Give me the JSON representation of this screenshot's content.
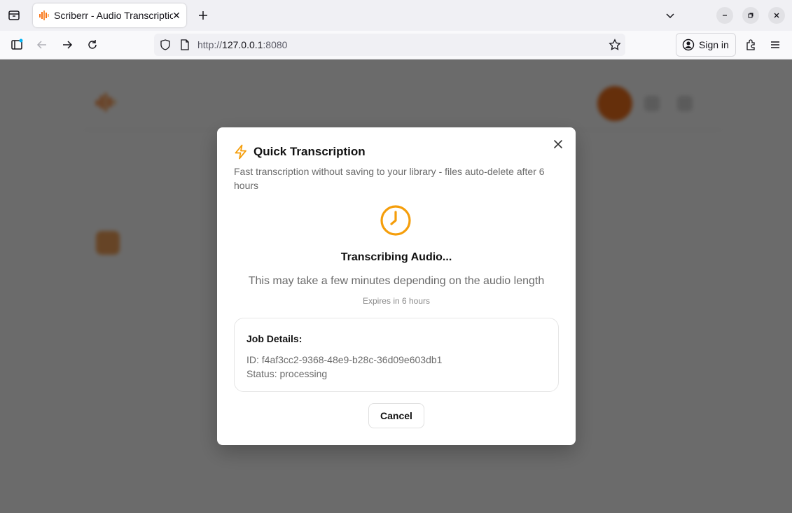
{
  "browser": {
    "tab": {
      "title": "Scriberr - Audio Transcription"
    },
    "url": {
      "scheme": "http://",
      "host": "127.0.0.1",
      "port": ":8080"
    },
    "sign_in_label": "Sign in"
  },
  "modal": {
    "title": "Quick Transcription",
    "description": "Fast transcription without saving to your library - files auto-delete after 6 hours",
    "status_title": "Transcribing Audio...",
    "status_subtitle": "This may take a few minutes depending on the audio length",
    "expires": "Expires in 6 hours",
    "details": {
      "title": "Job Details:",
      "id_line": "ID: f4af3cc2-9368-48e9-b28c-36d09e603db1",
      "status_line": "Status: processing"
    },
    "cancel_label": "Cancel"
  },
  "colors": {
    "accent": "#f59e0b",
    "overlay": "rgba(0,0,0,0.58)"
  }
}
